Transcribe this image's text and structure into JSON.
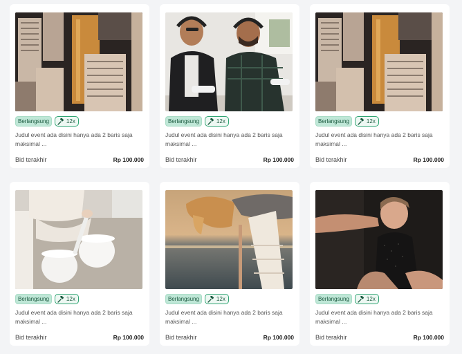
{
  "cards": [
    {
      "image": "city-skyscrapers-photo",
      "status": "Berlangsung",
      "bid_count": "12x",
      "description": "Judul event ada disini hanya ada 2 baris saja maksimal ...",
      "bid_label": "Bid terakhir",
      "price": "Rp 100.000"
    },
    {
      "image": "gamers-with-controllers-photo",
      "status": "Berlangsung",
      "bid_count": "12x",
      "description": "Judul event ada disini hanya ada 2 baris saja maksimal ...",
      "bid_label": "Bid terakhir",
      "price": "Rp 100.000"
    },
    {
      "image": "city-skyscrapers-photo",
      "status": "Berlangsung",
      "bid_count": "12x",
      "description": "Judul event ada disini hanya ada 2 baris saja maksimal ...",
      "bid_label": "Bid terakhir",
      "price": "Rp 100.000"
    },
    {
      "image": "singing-bowls-photo",
      "status": "Berlangsung",
      "bid_count": "12x",
      "description": "Judul event ada disini hanya ada 2 baris saja maksimal ...",
      "bid_label": "Bid terakhir",
      "price": "Rp 100.000"
    },
    {
      "image": "woman-at-beach-sunset-photo",
      "status": "Berlangsung",
      "bid_count": "12x",
      "description": "Judul event ada disini hanya ada 2 baris saja maksimal ...",
      "bid_label": "Bid terakhir",
      "price": "Rp 100.000"
    },
    {
      "image": "baby-portrait-photo",
      "status": "Berlangsung",
      "bid_count": "12x",
      "description": "Judul event ada disini hanya ada 2 baris saja maksimal ...",
      "bid_label": "Bid terakhir",
      "price": "Rp 100.000"
    }
  ],
  "colors": {
    "status_bg": "#bfe7d7",
    "status_text": "#1c5a40",
    "bid_border": "#2fa573",
    "page_bg": "#f3f4f6"
  }
}
